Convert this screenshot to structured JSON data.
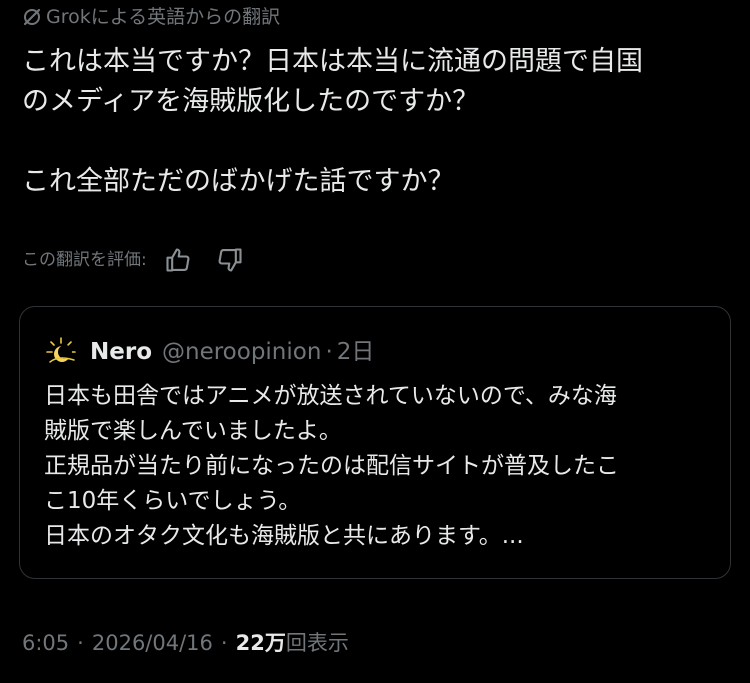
{
  "translation": {
    "label": "Grokによる英語からの翻訳",
    "icon": "grok-icon"
  },
  "tweet": {
    "lines": [
      "これは本当ですか？日本は本当に流通の問題で自国",
      "のメディアを海賊版化したのですか？",
      "",
      "これ全部ただのばかげた話ですか？"
    ]
  },
  "rating": {
    "label": "この翻訳を評価:",
    "up_icon": "thumbs-up-icon",
    "down_icon": "thumbs-down-icon"
  },
  "quote": {
    "name": "Nero",
    "handle": "@neroopinion",
    "separator": "·",
    "time": "2日",
    "lines": [
      "日本も田舎ではアニメが放送されていないので、みな海",
      "賊版で楽しんでいましたよ。",
      "正規品が当たり前になったのは配信サイトが普及したこ",
      "こ10年くらいでしょう。",
      "日本のオタク文化も海賊版と共にあります。..."
    ]
  },
  "meta": {
    "time": "6:05",
    "separator": "·",
    "date": "2026/04/16",
    "views_count": "22万",
    "views_label": "回表示"
  },
  "colors": {
    "background": "#000000",
    "text": "#e7e9ea",
    "muted": "#71767b",
    "border": "#2f3336"
  }
}
